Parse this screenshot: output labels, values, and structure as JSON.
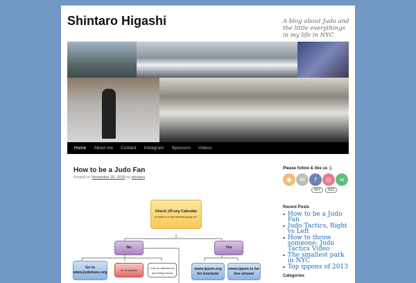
{
  "site": {
    "title": "Shintaro Higashi",
    "tagline": "A blog about Judo and the little everythings in my life in NYC"
  },
  "nav": [
    "Home",
    "About me",
    "Contact",
    "Instagram",
    "Sponsors",
    "Videos"
  ],
  "post": {
    "title": "How to be a Judo Fan",
    "posted_on": "Posted on",
    "date": "November 20, 2015",
    "by": "by",
    "author": "shintaro"
  },
  "flowchart": {
    "check": "Check IJF.org Calendar",
    "check_sub": "Is there is a Tournament going on?",
    "no": "No",
    "yes": "Yes",
    "judobase": "Go to www.judobase.org",
    "youtube": "Go to youtube",
    "calendar": "Look at calendar for upcoming events",
    "ippon_org": "www.ippon.org for brackets",
    "ippon_tv": "www.ippon.tv for live stream"
  },
  "sidebar": {
    "follow_title": "Please follow & like us :)",
    "icons": [
      "rss-icon",
      "email-icon",
      "facebook-icon",
      "instagram-icon",
      "share-icon"
    ],
    "counts": [
      "997",
      "815"
    ],
    "recent_title": "Recent Posts",
    "recent": [
      "How to be a Judo Fan",
      "Judo Tactics, Right vs Left",
      "How to throw someone: Judo Tactics Video",
      "The smallest park in NYC",
      "Top ippons of 2013"
    ],
    "categories_title": "Categories"
  }
}
